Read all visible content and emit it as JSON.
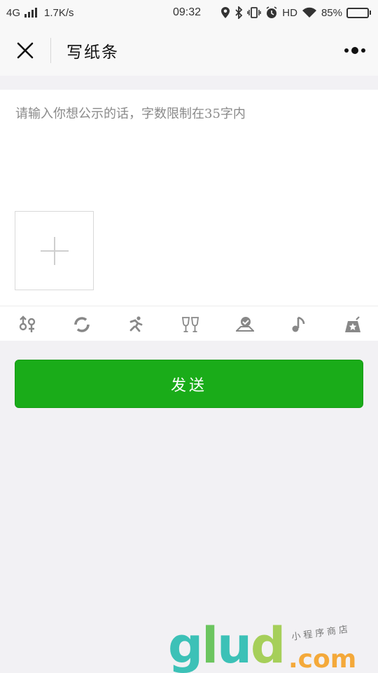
{
  "status_bar": {
    "network": "4G",
    "speed": "1.7K/s",
    "time": "09:32",
    "hd": "HD",
    "battery": "85%",
    "battery_level": 0.85,
    "icons": [
      "signal-icon",
      "location-icon",
      "bluetooth-icon",
      "vibrate-icon",
      "alarm-icon",
      "wifi-icon",
      "battery-icon"
    ]
  },
  "nav": {
    "title": "写纸条",
    "close_icon": "close-icon",
    "more_icon": "more-icon"
  },
  "editor": {
    "placeholder": "请输入你想公示的话，字数限制在35字内",
    "value": "",
    "add_image_icon": "plus-icon"
  },
  "toolbar": {
    "icons": [
      "gender-icon",
      "refresh-icon",
      "running-icon",
      "cheers-icon",
      "location-chat-icon",
      "music-icon",
      "star-bag-icon"
    ],
    "color": "#888888"
  },
  "send_button": {
    "label": "发送",
    "color": "#1aac19"
  },
  "watermark": {
    "logo": "glud",
    "domain": ".com",
    "tagline": "小程序商店"
  }
}
